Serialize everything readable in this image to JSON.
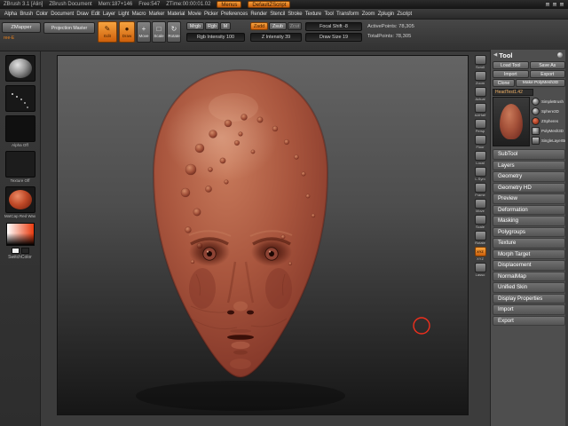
{
  "colors": {
    "accent": "#e8831e",
    "canvas_top": "#646464",
    "canvas_bottom": "#161616",
    "head_base": "#a9563e",
    "cursor_red": "#ef2f1d"
  },
  "icons": {
    "edit": "✎",
    "draw": "●",
    "move": "+",
    "scale": "□",
    "rotate": "↻",
    "panel_collapse": "◀"
  },
  "title_bar": {
    "app_title": "ZBrush 3.1 [Alin]",
    "doc_title": "ZBrush Document",
    "mem": "Mem:187+146",
    "free": "Free:547",
    "ztime": "ZTime:00:00:01.02",
    "menus_button": "Menus",
    "zscript_button": "DefaultZScript"
  },
  "menu_bar": {
    "items": [
      "Alpha",
      "Brush",
      "Color",
      "Document",
      "Draw",
      "Edit",
      "Layer",
      "Light",
      "Macro",
      "Marker",
      "Material",
      "Movie",
      "Picker",
      "Preferences",
      "Render",
      "Stencil",
      "Stroke",
      "Texture",
      "Tool",
      "Transform",
      "Zoom",
      "Zplugin",
      "Zscript"
    ]
  },
  "toolbar": {
    "zmapper": "ZMapper",
    "zmapper_note": "ree-E",
    "projection_master": "Projection Master",
    "edit": "Edit",
    "draw": "Draw",
    "move": "Move",
    "scale": "Scale",
    "rotate": "Rotate",
    "mrgb": "Mrgb",
    "rgb": "Rgb",
    "m": "M",
    "rgb_intensity": "Rgb Intensity 100",
    "zadd": "Zadd",
    "zsub": "Zsub",
    "zcut": "Zcut",
    "z_intensity": "Z Intensity 39",
    "focal_shift": "Focal Shift -8",
    "draw_size": "Draw Size 19"
  },
  "status": {
    "active_points": "ActivePoints: 78,305",
    "total_points": "TotalPoints: 78,305"
  },
  "left_tray": {
    "alpha_label": "Alpha Off",
    "texture_label": "Texture Off",
    "material_label": "MatCap Red Wax",
    "switch_color": "SwitchColor"
  },
  "right_shelf": {
    "items": [
      {
        "label": "Scroll"
      },
      {
        "label": "Zoom"
      },
      {
        "label": "Actual"
      },
      {
        "label": "AAHalf"
      },
      {
        "label": "Persp"
      },
      {
        "label": "Floor"
      },
      {
        "label": "Local"
      },
      {
        "label": "L.Sym"
      },
      {
        "label": "Frame"
      },
      {
        "label": "Move"
      },
      {
        "label": "Scale"
      },
      {
        "label": "Rotate"
      },
      {
        "label": "XYZ",
        "state": "active",
        "glyph": "XYZ"
      },
      {
        "label": "Lasso"
      }
    ]
  },
  "tool_panel": {
    "title": "Tool",
    "load_tool": "Load Tool",
    "save_as": "Save As",
    "import": "Import",
    "export": "Export",
    "clone": "Clone",
    "make_polymesh": "Make PolyMesh3D",
    "active_tool_name": "HeadTest1.42",
    "quick_picks": [
      {
        "label": "SimpleBrush",
        "icon": "qp-sphere"
      },
      {
        "label": "Sphere3D",
        "icon": "qp-sphere"
      },
      {
        "label": "ZSpheres",
        "icon": "qp-red"
      },
      {
        "label": "PolyMesh3D",
        "icon": "qp-poly"
      },
      {
        "label": "SingleLayerBrush",
        "icon": "qp-layer"
      }
    ],
    "sections": [
      "SubTool",
      "Layers",
      "Geometry",
      "Geometry HD",
      "Preview",
      "Deformation",
      "Masking",
      "Polygroups",
      "Texture",
      "Morph Target",
      "Displacement",
      "NormalMap",
      "Unified Skin",
      "Display Properties",
      "Import",
      "Export"
    ]
  }
}
